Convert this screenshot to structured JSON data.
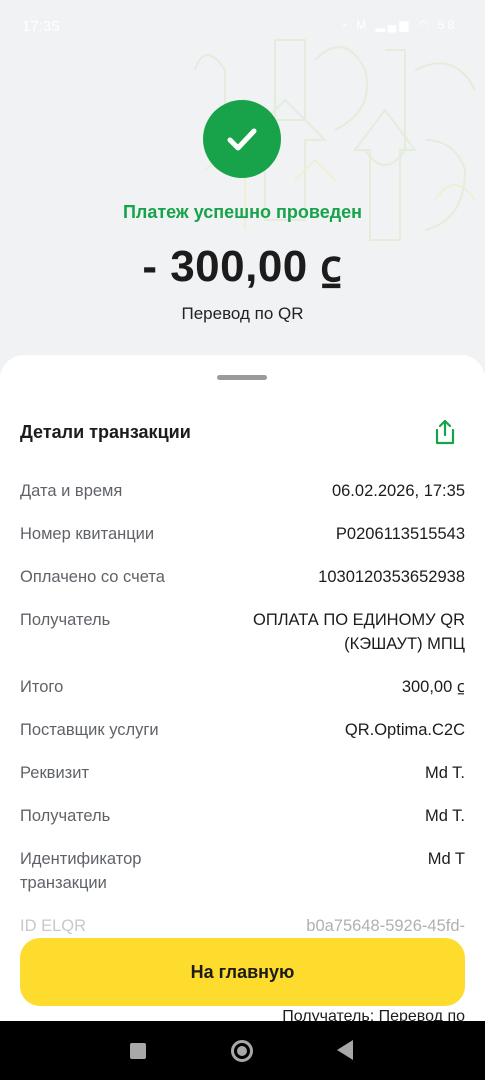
{
  "status_bar": {
    "time": "17:35",
    "icons": "◔ M  ▂▄▆ ◠ 58"
  },
  "header": {
    "success_text": "Платеж успешно проведен",
    "amount": "- 300,00 ⃀",
    "payment_type": "Перевод по QR",
    "accent": "#16a34a"
  },
  "details": {
    "title": "Детали транзакции",
    "rows": [
      {
        "label": "Дата и время",
        "value": "06.02.2026, 17:35"
      },
      {
        "label": "Номер квитанции",
        "value": "P0206113515543"
      },
      {
        "label": "Оплачено со счета",
        "value": "1030120353652938"
      },
      {
        "label": "Получатель",
        "value": "ОПЛАТА ПО ЕДИНОМУ QR (КЭШАУТ) МПЦ"
      },
      {
        "label": "Итого",
        "value": "300,00 ⃀"
      },
      {
        "label": "Поставщик услуги",
        "value": "QR.Optima.C2C"
      },
      {
        "label": "Реквизит",
        "value": "Md T."
      },
      {
        "label": "Получатель",
        "value": "Md T."
      },
      {
        "label": "Идентификатор транзакции",
        "value": "Md T"
      },
      {
        "label": "ID ELQR",
        "value": "b0a75648-5926-45fd-"
      }
    ],
    "behind_text": "Получатель: Перевод по"
  },
  "actions": {
    "home_label": "На главную",
    "button_color": "#fddc2d"
  }
}
